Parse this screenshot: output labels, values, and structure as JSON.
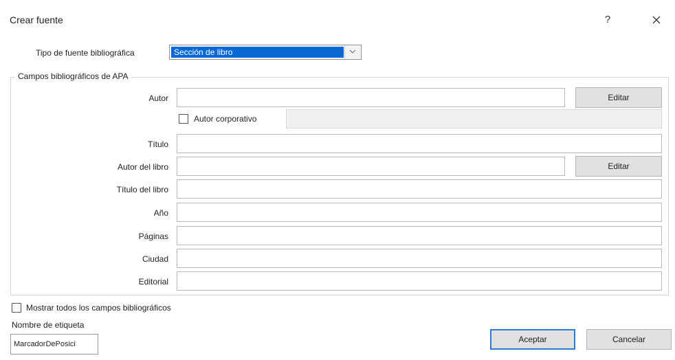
{
  "dialog": {
    "title": "Crear fuente",
    "help_label": "?",
    "close_icon": "close-icon"
  },
  "source_type": {
    "label": "Tipo de fuente bibliográfica",
    "selected": "Sección de libro"
  },
  "group": {
    "legend": "Campos bibliográficos de APA"
  },
  "fields": {
    "autor": {
      "label": "Autor",
      "value": "",
      "edit_label": "Editar"
    },
    "corporate_author": {
      "label": "Autor corporativo",
      "checked": false,
      "value": ""
    },
    "titulo": {
      "label": "Título",
      "value": ""
    },
    "autor_libro": {
      "label": "Autor del libro",
      "value": "",
      "edit_label": "Editar"
    },
    "titulo_libro": {
      "label": "Título del libro",
      "value": ""
    },
    "anio": {
      "label": "Año",
      "value": ""
    },
    "paginas": {
      "label": "Páginas",
      "value": ""
    },
    "ciudad": {
      "label": "Ciudad",
      "value": ""
    },
    "editorial": {
      "label": "Editorial",
      "value": ""
    }
  },
  "show_all": {
    "label": "Mostrar todos los campos bibliográficos",
    "checked": false
  },
  "tag_name": {
    "label": "Nombre de etiqueta",
    "value": "MarcadorDePosici"
  },
  "buttons": {
    "accept": "Aceptar",
    "cancel": "Cancelar"
  }
}
